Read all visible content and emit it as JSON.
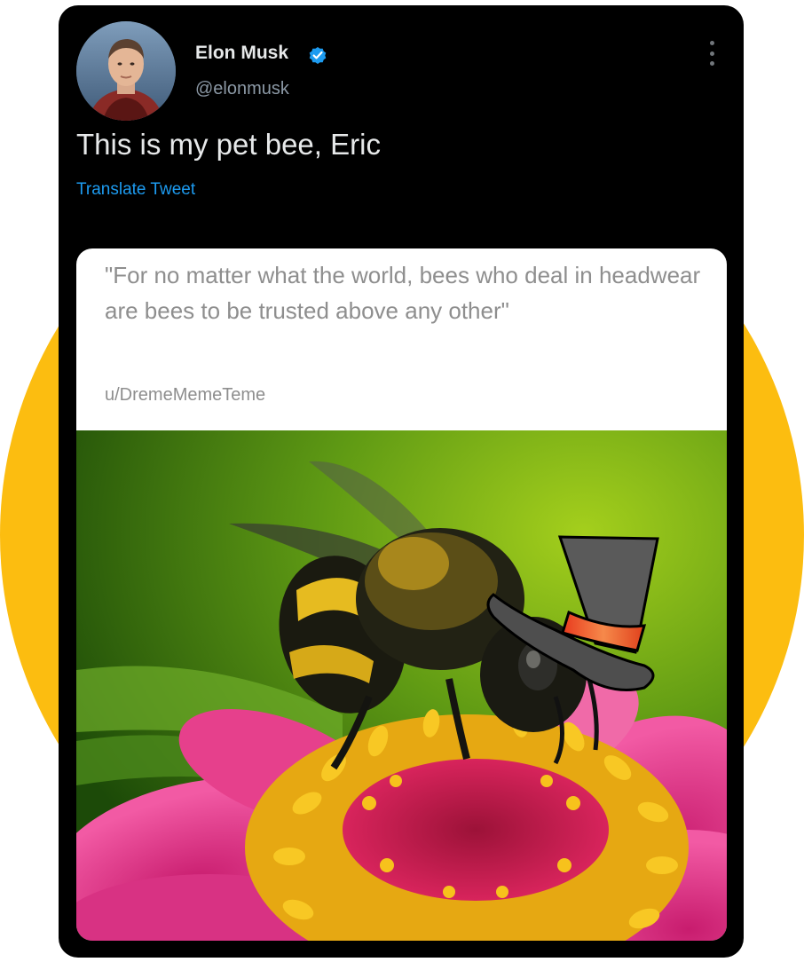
{
  "colors": {
    "background_circle": "#fcbd10",
    "card": "#000000",
    "link": "#1d9bf0",
    "verified": "#1d9bf0"
  },
  "tweet": {
    "author_name": "Elon Musk",
    "author_handle": "@elonmusk",
    "verified_icon": "verified-badge-icon",
    "more_icon": "more-options-icon",
    "text": "This is my pet bee, Eric",
    "translate_label": "Translate Tweet"
  },
  "media": {
    "quote": "\"For no matter what the world, bees who deal in headwear are bees to be trusted above any other\"",
    "quote_author": "u/DremeMemeTeme"
  }
}
